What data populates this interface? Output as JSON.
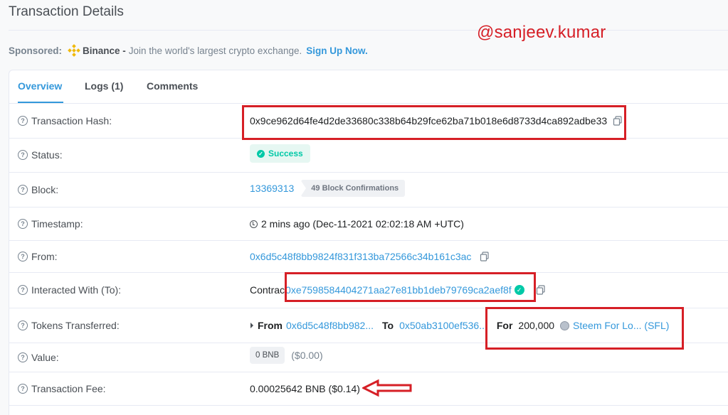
{
  "page": {
    "title": "Transaction Details",
    "watermark": "@sanjeev.kumar"
  },
  "sponsored": {
    "label": "Sponsored:",
    "brand": "Binance -",
    "description": "Join the world's largest crypto exchange.",
    "cta": "Sign Up Now."
  },
  "tabs": [
    {
      "label": "Overview",
      "active": true
    },
    {
      "label": "Logs (1)",
      "active": false
    },
    {
      "label": "Comments",
      "active": false
    }
  ],
  "rows": {
    "hash": {
      "label": "Transaction Hash:",
      "value": "0x9ce962d64fe4d2de33680c338b64b29fce62ba71b018e6d8733d4ca892adbe33"
    },
    "status": {
      "label": "Status:",
      "value": "Success"
    },
    "block": {
      "label": "Block:",
      "value": "13369313",
      "confirmations": "49 Block Confirmations"
    },
    "timestamp": {
      "label": "Timestamp:",
      "value": "2 mins ago (Dec-11-2021 02:02:18 AM +UTC)"
    },
    "from": {
      "label": "From:",
      "value": "0x6d5c48f8bb9824f831f313ba72566c34b161c3ac"
    },
    "to": {
      "label": "Interacted With (To):",
      "prefix": "Contrac",
      "value": "0xe7598584404271aa27e81bb1deb79769ca2aef8f"
    },
    "tokens": {
      "label": "Tokens Transferred:",
      "from_label": "From",
      "from_value": "0x6d5c48f8bb982...",
      "to_label": "To",
      "to_value": "0x50ab3100ef536...",
      "for_label": "For",
      "amount": "200,000",
      "token": "Steem For Lo... (SFL)"
    },
    "value": {
      "label": "Value:",
      "amount": "0 BNB",
      "usd": "($0.00)"
    },
    "fee": {
      "label": "Transaction Fee:",
      "value": "0.00025642 BNB ($0.14)"
    }
  },
  "colors": {
    "accent": "#3498db",
    "success": "#00c9a7",
    "annotation": "#d61f26"
  },
  "icons": [
    "question-circle-icon",
    "copy-icon",
    "check-circle-icon",
    "clock-icon",
    "binance-logo-icon",
    "token-icon"
  ]
}
